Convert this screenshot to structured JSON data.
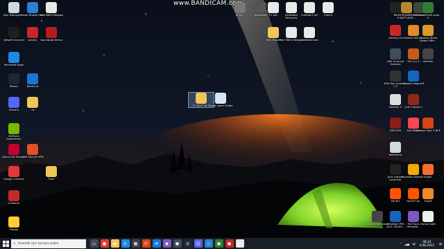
{
  "watermark": {
    "text": "www.BANDICAM.com"
  },
  "desktop_icons_left": [
    {
      "label": "Geri Dönüşüm...",
      "color": "#cfd8e0"
    },
    {
      "label": "Visual Studio Code",
      "color": "#2a7fd4"
    },
    {
      "label": "Yeni Metin Belgesi",
      "color": "#e8e8e8"
    },
    {
      "label": "Ubisoft Connect",
      "color": "#1e1e1e"
    },
    {
      "label": "zpicker",
      "color": "#c62828"
    },
    {
      "label": "Soundpad Demo",
      "color": "#b71c1c"
    },
    {
      "label": "Microsoft Edge",
      "color": "#1e88e5"
    },
    {
      "label": "Steam",
      "color": "#1b2838"
    },
    {
      "label": "Bandicut",
      "color": "#1976d2"
    },
    {
      "label": "Discord",
      "color": "#5865f2"
    },
    {
      "label": ".ss",
      "color": "#f1c55a"
    },
    {
      "label": "GeForce Experience",
      "color": "#76b900"
    },
    {
      "label": "Opera GX Tarayıcı",
      "color": "#c3002f"
    },
    {
      "label": "AVG Secure VPN",
      "color": "#e0512a"
    },
    {
      "label": "Google Chrome",
      "color": "#e53935"
    },
    {
      "label": "Final",
      "color": "#f1c55a"
    },
    {
      "label": "CCleaner",
      "color": "#c62828"
    },
    {
      "label": "Hesap",
      "color": "#ffcc33"
    }
  ],
  "desktop_icons_top": [
    {
      "label": "Nİ Nİ...",
      "color": "#777777"
    },
    {
      "label": "Aktifleştir",
      "color": "#555555"
    },
    {
      "label": "F1 key",
      "color": "#e8e8e8"
    },
    {
      "label": "Keyboard Recovery",
      "color": "#e8e8e8"
    },
    {
      "label": "Furkaan7.dll",
      "color": "#e8e8e8"
    },
    {
      "label": "macro",
      "color": "#e8e8e8"
    },
    {
      "label": "Yeni Klasör",
      "color": "#f1c55a"
    },
    {
      "label": "Yeni Metin Belgesi",
      "color": "#e8e8e8"
    },
    {
      "label": "willbebanned",
      "color": "#e8e8e8"
    }
  ],
  "desktop_icons_center": [
    {
      "label": "F7 Yüz F Nİ...",
      "color": "#f1c55a",
      "selected": true
    },
    {
      "label": "Steam open Folder",
      "color": "#d9e6f2",
      "selected": false
    }
  ],
  "desktop_icons_right": [
    {
      "label": "F1",
      "color": "#222222"
    },
    {
      "label": "PLAYERUNKNOWN'S BATTLEGR...",
      "color": "#b8862f"
    },
    {
      "label": "The Forest",
      "color": "#3b4a30"
    },
    {
      "label": "Grand Theft Auto V",
      "color": "#2e7d32"
    },
    {
      "label": "Among Us",
      "color": "#c62828"
    },
    {
      "label": "Human Fall Flat",
      "color": "#e08a2a"
    },
    {
      "label": "Counter-Strike Global Offe...",
      "color": "#d99a2b"
    },
    {
      "label": "ARK Survival Evolved",
      "color": "#3e4f5a"
    },
    {
      "label": "Far Cry 4",
      "color": "#c65a1c"
    },
    {
      "label": "Valheim",
      "color": "#444444"
    },
    {
      "label": "MTA San Andreas 1.5",
      "color": "#333333"
    },
    {
      "label": "Rocket League®",
      "color": "#1565c0"
    },
    {
      "label": "Destiny 2",
      "color": "#dddddd"
    },
    {
      "label": "Left 4 Dead 2",
      "color": "#8d2a1a"
    },
    {
      "label": "DEVOUR",
      "color": "#8e1b1b"
    },
    {
      "label": "VALORANT",
      "color": "#ff4655"
    },
    {
      "label": "Serious Sam 3 BFE",
      "color": "#d84315"
    },
    {
      "label": "Warframe",
      "color": "#cfd8dc"
    },
    {
      "label": "Epic Games Launcher",
      "color": "#222222"
    },
    {
      "label": "Rockstar Games...",
      "color": "#f2a900"
    },
    {
      "label": "Origin",
      "color": "#f56c2d"
    },
    {
      "label": "FACEIT",
      "color": "#ff5500"
    },
    {
      "label": "FACEIT AC",
      "color": "#ff5500"
    },
    {
      "label": "FiveM",
      "color": "#f08a24"
    },
    {
      "label": "Nefes2/era Kosaçi",
      "color": "#444444"
    },
    {
      "label": "eFootball PES 2021 SEASO...",
      "color": "#1565c0"
    },
    {
      "label": "Fall Guys Ultimate...",
      "color": "#7e57c2"
    },
    {
      "label": "Dying Light",
      "color": "#eeeeee"
    }
  ],
  "taskbar": {
    "search_placeholder": "Aramak için buraya yazın",
    "apps": [
      {
        "name": "task-view-icon",
        "color": "#444a55",
        "glyph": "▭"
      },
      {
        "name": "chrome-icon",
        "color": "#e53935",
        "glyph": "●"
      },
      {
        "name": "file-explorer-icon",
        "color": "#f1c55a",
        "glyph": "▬"
      },
      {
        "name": "edge-icon",
        "color": "#1e88e5",
        "glyph": "e"
      },
      {
        "name": "store-icon",
        "color": "#3a3f48",
        "glyph": "▦"
      },
      {
        "name": "office-icon",
        "color": "#d84315",
        "glyph": "O"
      },
      {
        "name": "mail-icon",
        "color": "#1976d2",
        "glyph": "✉"
      },
      {
        "name": "visual-studio-icon",
        "color": "#7e57c2",
        "glyph": "◆"
      },
      {
        "name": "bandicam-icon",
        "color": "#444a55",
        "glyph": "●"
      },
      {
        "name": "steam-icon",
        "color": "#1b2838",
        "glyph": "◎"
      },
      {
        "name": "discord-icon",
        "color": "#5865f2",
        "glyph": "☺"
      },
      {
        "name": "vscode-icon",
        "color": "#2a7fd4",
        "glyph": "◇"
      },
      {
        "name": "game-icon",
        "color": "#2e7d32",
        "glyph": "▣"
      },
      {
        "name": "record-icon",
        "color": "#c62828",
        "glyph": "●"
      },
      {
        "name": "notes-icon",
        "color": "#e8e8e8",
        "glyph": "▤"
      }
    ],
    "time": "08:24",
    "date": "9.06.2021"
  }
}
